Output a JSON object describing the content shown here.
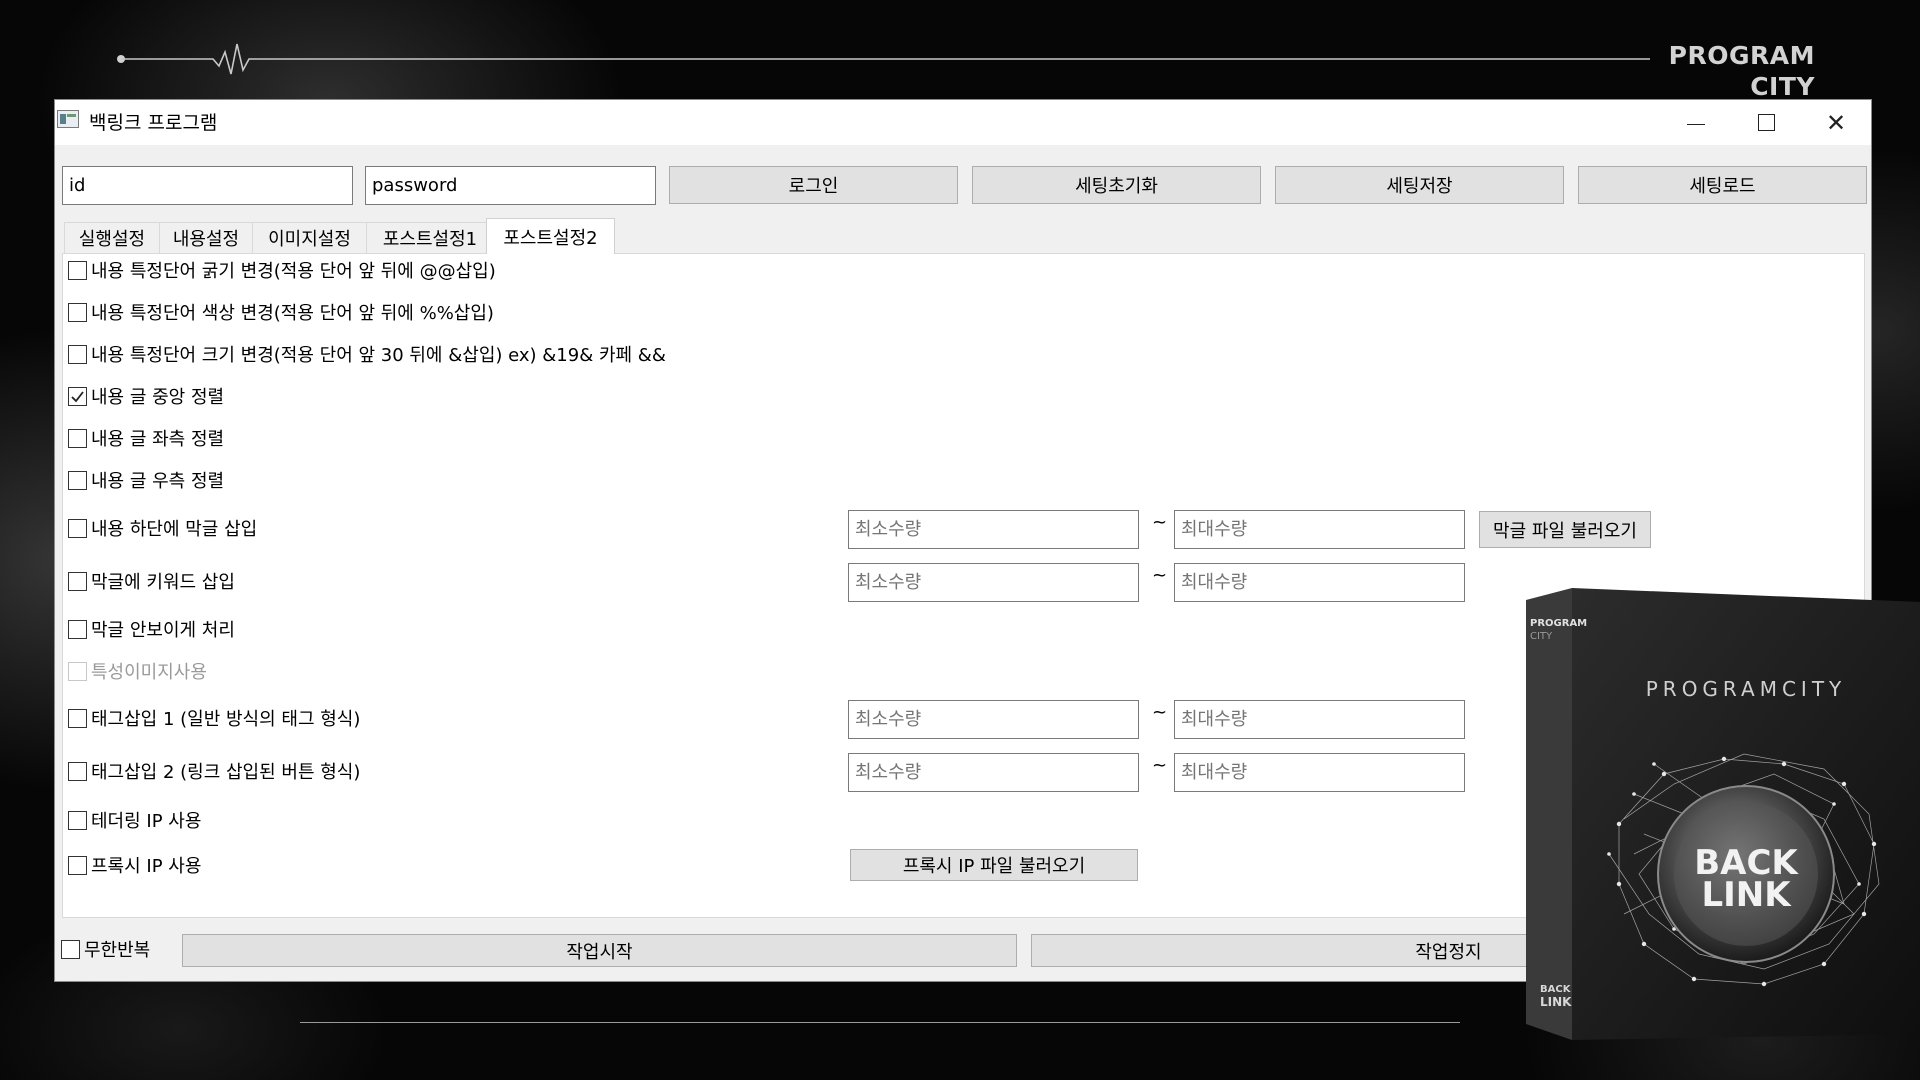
{
  "brand": {
    "line1": "PROGRAM",
    "line2": "CITY"
  },
  "window": {
    "title": "백링크 프로그램",
    "minimize": "–",
    "close": "✕"
  },
  "login": {
    "id_value": "id",
    "password_value": "password",
    "login_btn": "로그인",
    "reset_btn": "세팅초기화",
    "save_btn": "세팅저장",
    "load_btn": "세팅로드"
  },
  "tabs": [
    {
      "label": "실행설정",
      "active": false
    },
    {
      "label": "내용설정",
      "active": false
    },
    {
      "label": "이미지설정",
      "active": false
    },
    {
      "label": "포스트설정1",
      "active": false
    },
    {
      "label": "포스트설정2",
      "active": true
    }
  ],
  "options": [
    {
      "label": "내용 특정단어 굵기 변경(적용 단어 앞 뒤에 @@삽입)",
      "checked": false
    },
    {
      "label": "내용 특정단어 색상 변경(적용 단어 앞 뒤에 %%삽입)",
      "checked": false
    },
    {
      "label": "내용 특정단어 크기 변경(적용 단어 앞 30 뒤에 &삽입) ex) &19& 카페 &&",
      "checked": false
    },
    {
      "label": "내용 글 중앙 정렬",
      "checked": true
    },
    {
      "label": "내용 글 좌측 정렬",
      "checked": false
    },
    {
      "label": "내용 글 우측 정렬",
      "checked": false
    },
    {
      "label": "내용 하단에 막글 삽입",
      "checked": false
    },
    {
      "label": "막글에 키워드 삽입",
      "checked": false
    },
    {
      "label": "막글 안보이게 처리",
      "checked": false
    },
    {
      "label": "특성이미지사용",
      "checked": false,
      "disabled": true
    },
    {
      "label": "태그삽입 1 (일반 방식의 태그 형식)",
      "checked": false
    },
    {
      "label": "태그삽입 2 (링크 삽입된 버튼 형식)",
      "checked": false
    },
    {
      "label": "테더링 IP 사용",
      "checked": false
    },
    {
      "label": "프록시 IP 사용",
      "checked": false
    }
  ],
  "range": {
    "min_placeholder": "최소수량",
    "max_placeholder": "최대수량",
    "tilde": "~"
  },
  "buttons": {
    "load_filler_file": "막글 파일 불러오기",
    "load_proxy_file": "프록시 IP 파일 불러오기",
    "start": "작업시작",
    "stop": "작업정지"
  },
  "bottom": {
    "infinite_repeat_label": "무한반복",
    "infinite_repeat_checked": false
  },
  "product_box": {
    "side_line1": "PROGRAM",
    "side_line2": "CITY",
    "front_brand": "PROGRAMCITY",
    "logo_line1": "BACK",
    "logo_line2": "LINK",
    "side_logo1": "BACK",
    "side_logo2": "LINK"
  },
  "colors": {
    "background": "#060606",
    "window": "#f0f0f0",
    "panel": "#ffffff",
    "button": "#e1e1e1"
  }
}
